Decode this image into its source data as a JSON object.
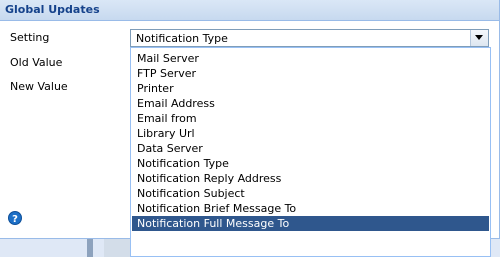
{
  "dialog": {
    "title": "Global Updates"
  },
  "form": {
    "setting_label": "Setting",
    "old_value_label": "Old Value",
    "new_value_label": "New Value",
    "setting_value": "Notification Type"
  },
  "dropdown": {
    "items": [
      "Mail Server",
      "FTP Server",
      "Printer",
      "Email Address",
      "Email from",
      "Library Url",
      "Data Server",
      "Notification Type",
      "Notification Reply Address",
      "Notification Subject",
      "Notification Brief Message To",
      "Notification Full Message To"
    ],
    "highlighted": "Notification Full Message To"
  },
  "colors": {
    "highlight_bg": "#2f578d",
    "title_text": "#15428b",
    "help_icon": "#1c6fc7"
  }
}
